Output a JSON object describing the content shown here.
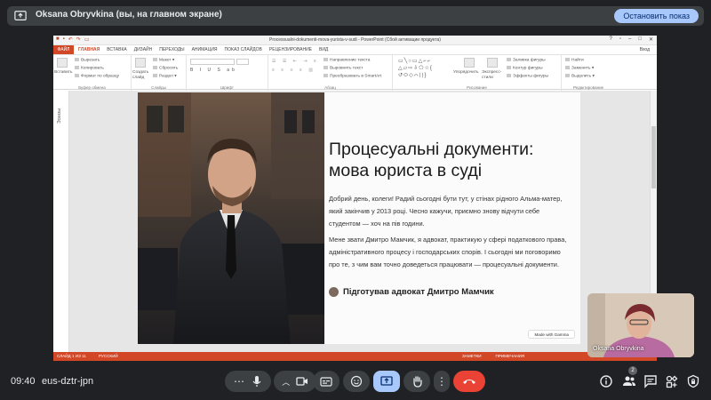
{
  "banner": {
    "title": "Oksana Obryvkina (вы, на главном экране)",
    "stop_button": "Остановить показ"
  },
  "ppt": {
    "doc_title": "Processualni-dokumenti-mova-yurista-v-sudi - PowerPoint (Сбой активации продукта)",
    "tabs": {
      "file": "ФАЙЛ",
      "items": [
        "ГЛАВНАЯ",
        "ВСТАВКА",
        "ДИЗАЙН",
        "ПЕРЕХОДЫ",
        "АНИМАЦИЯ",
        "ПОКАЗ СЛАЙДОВ",
        "РЕЦЕНЗИРОВАНИЕ",
        "ВИД"
      ],
      "login": "Вход"
    },
    "ribbon": {
      "clipboard": {
        "paste": "Вставить",
        "cut": "Вырезать",
        "copy": "Копировать",
        "format_painter": "Формат по образцу",
        "label": "Буфер обмена"
      },
      "slides": {
        "create": "Создать слайд",
        "layout": "Макет",
        "reset": "Сбросить",
        "section": "Раздел",
        "label": "Слайды"
      },
      "font": {
        "label": "Шрифт"
      },
      "paragraph": {
        "text_direction": "Направление текста",
        "align_text": "Выровнять текст",
        "smartart": "Преобразовать в SmartArt",
        "label": "Абзац"
      },
      "drawing": {
        "arrange": "Упорядочить",
        "quick_styles": "Экспресс-стили",
        "shape_fill": "Заливка фигуры",
        "shape_outline": "Контур фигуры",
        "shape_effects": "Эффекты фигуры",
        "label": "Рисование"
      },
      "editing": {
        "find": "Найти",
        "replace": "Заменить",
        "select": "Выделить",
        "label": "Редактирование"
      }
    },
    "thumbs_label": "Эскизы",
    "statusbar": {
      "slide": "СЛАЙД 1 ИЗ 11",
      "language": "РУССКИЙ",
      "notes": "ЗАМЕТКИ",
      "comments": "ПРИМЕЧАНИЯ"
    }
  },
  "slide": {
    "title": "Процесуальні документи: мова юриста в суді",
    "p1": "Добрий день, колеги! Радий сьогодні бути тут, у стінах рідного Альма-матер, який закінчив у 2013 році. Чесно кажучи, приємно знову відчути себе студентом — хоч на пів години.",
    "p2": "Мене звати Дмитро Мамчик, я адвокат, практикую у сфері податкового права, адміністративного процесу і господарських спорів. І сьогодні ми поговоримо про те, з чим вам точно доведеться працювати — процесуальні документи.",
    "author": "Підготував адвокат Дмитро Мамчик",
    "gamma": "Made with Gamma"
  },
  "selfview": {
    "name": "Oksana Obryvkina"
  },
  "bottom": {
    "time": "09:40",
    "meeting_code": "eus-dztr-jpn",
    "participants_badge": "2"
  },
  "colors": {
    "accent_ppt": "#d24726",
    "end_call": "#ea4335",
    "present_active": "#a8c7fa",
    "meet_bg": "#202124"
  }
}
